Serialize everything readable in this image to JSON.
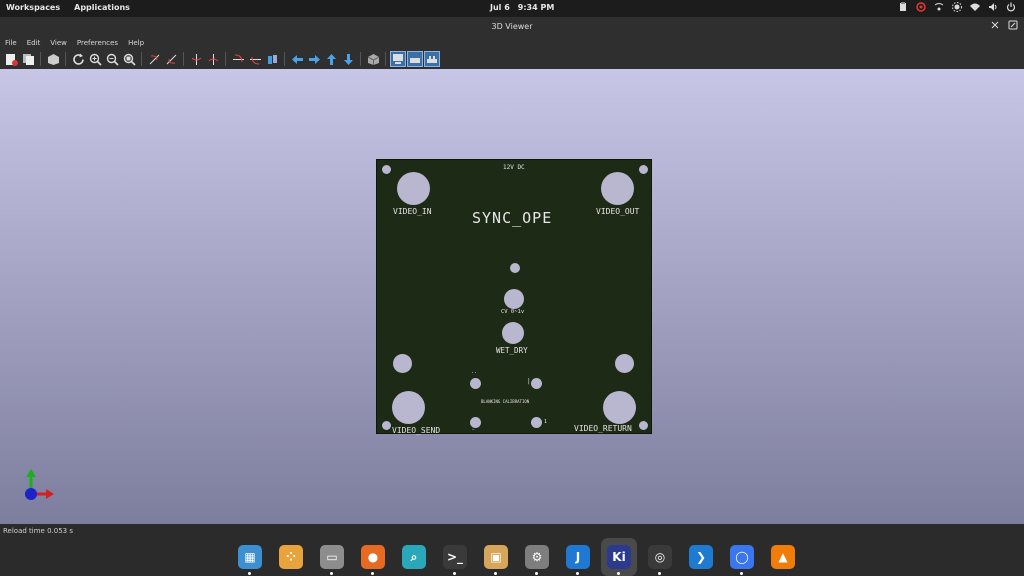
{
  "system_bar": {
    "workspaces_label": "Workspaces",
    "applications_label": "Applications",
    "date": "Jul 6",
    "time": "9:34 PM"
  },
  "window": {
    "title": "3D Viewer"
  },
  "menubar": {
    "items": [
      "File",
      "Edit",
      "View",
      "Preferences",
      "Help"
    ]
  },
  "board": {
    "labels": {
      "power": "12V DC",
      "title": "SYNC_OPE",
      "video_in": "VIDEO_IN",
      "video_out": "VIDEO_OUT",
      "cv": "CV 0~1v",
      "wet_dry": "WET_DRY",
      "blanking": "BLANKING CALIBRATION",
      "video_send": "VIDEO_SEND",
      "video_return": "VIDEO_RETURN",
      "mark_left_top": "..",
      "mark_right_top": "|",
      "mark_left_bottom": "—",
      "mark_right_bottom": "1"
    },
    "colors": {
      "pcb": "#1d2a16",
      "hole": "#b8b7cf",
      "silk": "#e6e6e6"
    }
  },
  "statusbar": {
    "text": "Reload time 0.053 s"
  },
  "dock": {
    "items": [
      {
        "name": "workspaces-app",
        "glyph": "▦",
        "color": "#3c8fd1",
        "running": true
      },
      {
        "name": "app-grid",
        "glyph": "⁘",
        "color": "#e8a33c",
        "running": false
      },
      {
        "name": "files",
        "glyph": "▭",
        "color": "#8d8d8d",
        "running": true
      },
      {
        "name": "firefox",
        "glyph": "●",
        "color": "#e66a22",
        "running": true
      },
      {
        "name": "search-app",
        "glyph": "⌕",
        "color": "#2aa7b8",
        "running": false
      },
      {
        "name": "terminal",
        "glyph": ">_",
        "color": "#3a3a3a",
        "running": true
      },
      {
        "name": "archive-manager",
        "glyph": "▣",
        "color": "#d7a65a",
        "running": true
      },
      {
        "name": "settings",
        "glyph": "⚙",
        "color": "#7e7e7e",
        "running": true
      },
      {
        "name": "joplin",
        "glyph": "J",
        "color": "#1f78d1",
        "running": true
      },
      {
        "name": "kicad",
        "glyph": "Ki",
        "color": "#2b3a8f",
        "running": true
      },
      {
        "name": "obs",
        "glyph": "◎",
        "color": "#3a3a3a",
        "running": true
      },
      {
        "name": "vscode",
        "glyph": "❯",
        "color": "#1f7bd1",
        "running": false
      },
      {
        "name": "signal",
        "glyph": "◯",
        "color": "#3a76f0",
        "running": true
      },
      {
        "name": "vlc",
        "glyph": "▲",
        "color": "#f07d0a",
        "running": false
      }
    ]
  }
}
